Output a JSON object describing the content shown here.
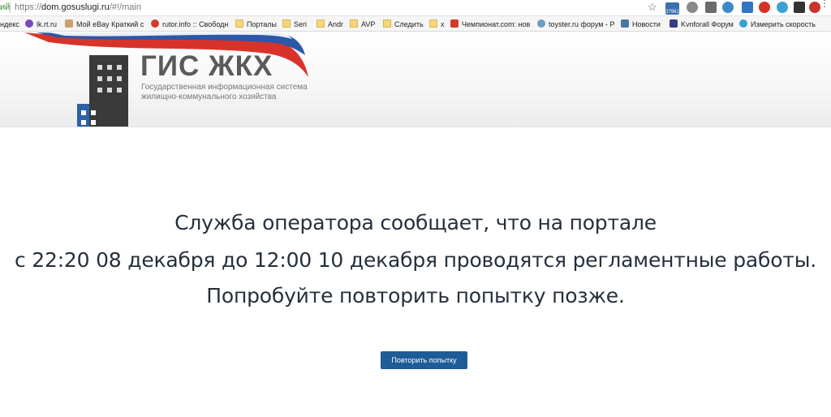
{
  "browser": {
    "addr_left_label": "ий",
    "url_scheme": "https://",
    "url_host": "dom.gosuslugi.ru",
    "url_path": "/#!/main",
    "bookmark_star": "☆",
    "ext_badge_count": "27961",
    "menu_icon": "⋮"
  },
  "bookmarks": [
    {
      "label": "ндекс",
      "icon": "yandex-icon",
      "color": "#e8e8e8"
    },
    {
      "label": "lk.rt.ru",
      "icon": "rt-icon",
      "color": "#7a4bb5"
    },
    {
      "label": "Мой eBay Краткий с",
      "icon": "ebay-icon",
      "color": "#c9a070"
    },
    {
      "label": "rutor.info :: Свободн",
      "icon": "rutor-icon",
      "color": "#d43a2a"
    },
    {
      "label": "Порталы",
      "icon": "folder-icon",
      "color": "#f5d77b"
    },
    {
      "label": "Seri",
      "icon": "folder-icon",
      "color": "#f5d77b"
    },
    {
      "label": "Andr",
      "icon": "folder-icon",
      "color": "#f5d77b"
    },
    {
      "label": "AVP",
      "icon": "folder-icon",
      "color": "#f5d77b"
    },
    {
      "label": "Следить",
      "icon": "folder-icon",
      "color": "#f5d77b"
    },
    {
      "label": "x",
      "icon": "folder-icon",
      "color": "#f5d77b"
    },
    {
      "label": "Чемпионат.com: нов",
      "icon": "championat-icon",
      "color": "#d43a2a"
    },
    {
      "label": "toyster.ru форум - Р",
      "icon": "toyster-icon",
      "color": "#6aa0c8"
    },
    {
      "label": "Новости",
      "icon": "vk-icon",
      "color": "#4a76a8"
    },
    {
      "label": "Kvnforall Форум",
      "icon": "kvn-icon",
      "color": "#3a3a8a"
    },
    {
      "label": "Измерить скорость",
      "icon": "speedtest-icon",
      "color": "#35a0d0"
    }
  ],
  "header": {
    "logo_title": "ГИС ЖКХ",
    "logo_subtitle_line1": "Государственная информационная система",
    "logo_subtitle_line2": "жилищно-коммунального хозяйства"
  },
  "main": {
    "message_line1": "Служба оператора сообщает, что на портале",
    "message_line2": "с 22:20 08 декабря до 12:00 10 декабря проводятся регламентные работы.",
    "message_line3": "Попробуйте повторить попытку позже.",
    "retry_button_label": "Повторить попытку"
  },
  "colors": {
    "accent": "#1e5c97",
    "text": "#26303c",
    "logo_blue": "#2b62a8"
  }
}
